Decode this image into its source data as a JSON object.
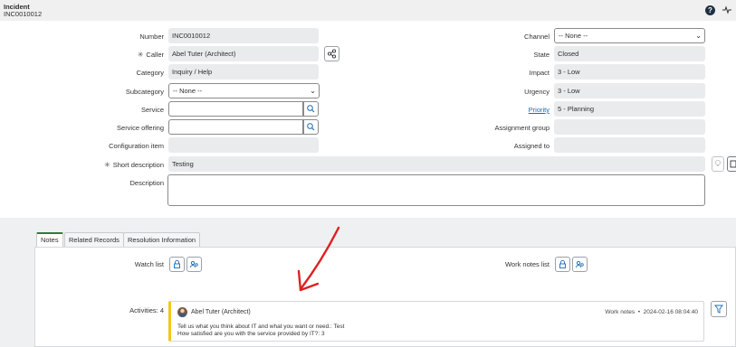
{
  "header": {
    "record_type": "Incident",
    "record_number": "INC0010012",
    "help_icon": "question-circle-icon",
    "pulse_icon": "activity-pulse-icon"
  },
  "form": {
    "number": {
      "label": "Number",
      "value": "INC0010012"
    },
    "caller": {
      "label": "Caller",
      "value": "Abel Tuter (Architect)",
      "required_mark": "✳"
    },
    "category": {
      "label": "Category",
      "value": "Inquiry / Help"
    },
    "subcategory": {
      "label": "Subcategory",
      "value": "-- None --"
    },
    "service": {
      "label": "Service",
      "value": ""
    },
    "service_offering": {
      "label": "Service offering",
      "value": ""
    },
    "configuration_item": {
      "label": "Configuration item",
      "value": ""
    },
    "short_description": {
      "label": "Short description",
      "value": "Testing",
      "required_mark": "✳"
    },
    "description": {
      "label": "Description",
      "value": ""
    },
    "channel": {
      "label": "Channel",
      "value": "-- None --"
    },
    "state": {
      "label": "State",
      "value": "Closed"
    },
    "impact": {
      "label": "Impact",
      "value": "3 - Low"
    },
    "urgency": {
      "label": "Urgency",
      "value": "3 - Low"
    },
    "priority": {
      "label": "Priority",
      "value": "5 - Planning"
    },
    "assignment_group": {
      "label": "Assignment group",
      "value": ""
    },
    "assigned_to": {
      "label": "Assigned to",
      "value": ""
    }
  },
  "tabs": [
    {
      "label": "Notes",
      "active": true
    },
    {
      "label": "Related Records",
      "active": false
    },
    {
      "label": "Resolution Information",
      "active": false
    }
  ],
  "notes": {
    "watch_list_label": "Watch list",
    "work_notes_list_label": "Work notes list",
    "activities_label": "Activities: 4"
  },
  "activity": {
    "author": "Abel Tuter (Architect)",
    "type": "Work notes",
    "separator": "•",
    "timestamp": "2024-02-16 08:04:40",
    "line1": "Tell us what you think about IT and what you want or need.: Test",
    "line2": "How satisfied are you with the service provided by IT?: 3"
  },
  "colors": {
    "header_bg": "#f0f0f0",
    "field_bg": "#e9ebed",
    "active_tab_accent": "#2e7d32",
    "activity_accent": "#f5c518",
    "annotation_arrow": "#e02020",
    "link": "#1a6bb5"
  }
}
